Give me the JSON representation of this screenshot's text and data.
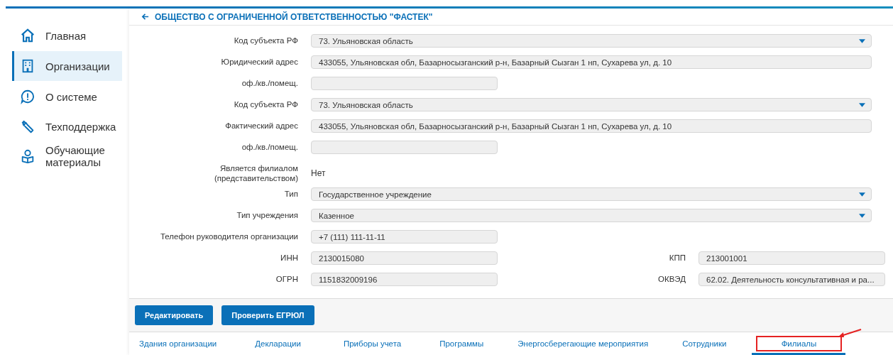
{
  "sidebar": {
    "items": [
      {
        "label": "Главная",
        "selected": false
      },
      {
        "label": "Организации",
        "selected": true
      },
      {
        "label": "О системе",
        "selected": false
      },
      {
        "label": "Техподдержка",
        "selected": false
      },
      {
        "label": "Обучающие материалы",
        "selected": false
      }
    ]
  },
  "header": {
    "title": "ОБЩЕСТВО С ОГРАНИЧЕННОЙ ОТВЕТСТВЕННОСТЬЮ \"ФАСТЕК\""
  },
  "form": {
    "rows": [
      {
        "kind": "select",
        "label": "Код субъекта РФ",
        "value": "73. Ульяновская область"
      },
      {
        "kind": "wide",
        "label": "Юридический адрес",
        "value": "433055, Ульяновская обл, Базарносызганский р-н, Базарный Сызган 1 нп, Сухарева ул, д. 10"
      },
      {
        "kind": "short",
        "label": "оф./кв./помещ.",
        "value": ""
      },
      {
        "kind": "select",
        "label": "Код субъекта РФ",
        "value": "73. Ульяновская область"
      },
      {
        "kind": "wide",
        "label": "Фактический адрес",
        "value": "433055, Ульяновская обл, Базарносызганский р-н, Базарный Сызган 1 нп, Сухарева ул, д. 10"
      },
      {
        "kind": "short",
        "label": "оф./кв./помещ.",
        "value": ""
      },
      {
        "kind": "text",
        "label": "Является филиалом (представительством)",
        "value": "Нет"
      },
      {
        "kind": "select",
        "label": "Тип",
        "value": "Государственное учреждение"
      },
      {
        "kind": "select",
        "label": "Тип учреждения",
        "value": "Казенное"
      },
      {
        "kind": "short",
        "label": "Телефон руководителя организации",
        "value": "+7 (111) 111-11-11"
      },
      {
        "kind": "pair",
        "left": {
          "label": "ИНН",
          "value": "2130015080"
        },
        "right": {
          "label": "КПП",
          "value": "213001001"
        }
      },
      {
        "kind": "pair",
        "left": {
          "label": "ОГРН",
          "value": "1151832009196"
        },
        "right": {
          "label": "ОКВЭД",
          "value": "62.02. Деятельность консультативная и ра..."
        }
      }
    ]
  },
  "actions": [
    "Редактировать",
    "Проверить ЕГРЮЛ"
  ],
  "tabs": [
    {
      "label": "Здания организации",
      "selected": false,
      "highlighted": false
    },
    {
      "label": "Декларации",
      "selected": false,
      "highlighted": false
    },
    {
      "label": "Приборы учета",
      "selected": false,
      "highlighted": false
    },
    {
      "label": "Программы",
      "selected": false,
      "highlighted": false
    },
    {
      "label": "Энергосберегающие мероприятия",
      "selected": false,
      "highlighted": false
    },
    {
      "label": "Сотрудники",
      "selected": false,
      "highlighted": false
    },
    {
      "label": "Филиалы",
      "selected": true,
      "highlighted": true
    }
  ]
}
